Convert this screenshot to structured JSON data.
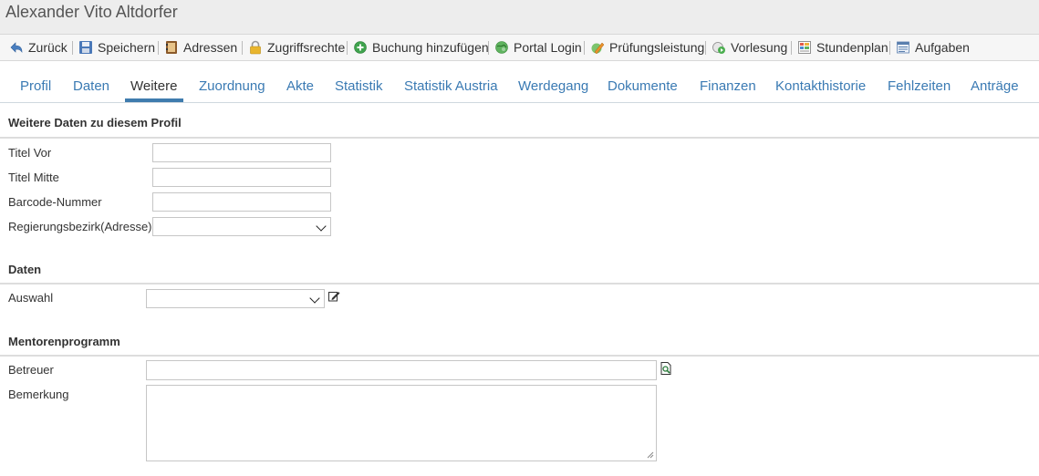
{
  "window": {
    "title": "Alexander Vito Altdorfer"
  },
  "toolbar": {
    "items": [
      {
        "label": "Zurück",
        "icon": "back-arrow-icon"
      },
      {
        "label": "Speichern",
        "icon": "floppy-disk-icon"
      },
      {
        "label": "Adressen",
        "icon": "address-book-icon"
      },
      {
        "label": "Zugriffsrechte",
        "icon": "padlock-icon"
      },
      {
        "label": "Buchung hinzufügen",
        "icon": "add-circle-icon"
      },
      {
        "label": "Portal Login",
        "icon": "globe-icon"
      },
      {
        "label": "Prüfungsleistung",
        "icon": "exam-pencil-icon"
      },
      {
        "label": "Vorlesung",
        "icon": "lecture-play-icon"
      },
      {
        "label": "Stundenplan",
        "icon": "timetable-icon"
      },
      {
        "label": "Aufgaben",
        "icon": "tasks-list-icon"
      }
    ]
  },
  "tabs": [
    {
      "label": "Profil"
    },
    {
      "label": "Daten"
    },
    {
      "label": "Weitere",
      "active": true
    },
    {
      "label": "Zuordnung"
    },
    {
      "label": "Akte"
    },
    {
      "label": "Statistik"
    },
    {
      "label": "Statistik Austria"
    },
    {
      "label": "Werdegang"
    },
    {
      "label": "Dokumente"
    },
    {
      "label": "Finanzen"
    },
    {
      "label": "Kontakthistorie"
    },
    {
      "label": "Fehlzeiten"
    },
    {
      "label": "Anträge"
    }
  ],
  "weitere": {
    "title": "Weitere Daten zu diesem Profil",
    "titel_vor": {
      "label": "Titel Vor",
      "value": ""
    },
    "titel_mitte": {
      "label": "Titel Mitte",
      "value": ""
    },
    "barcode": {
      "label": "Barcode-Nummer",
      "value": ""
    },
    "regierungsbezirk": {
      "label": "Regierungsbezirk(Adresse)",
      "value": ""
    }
  },
  "daten": {
    "title": "Daten",
    "auswahl": {
      "label": "Auswahl",
      "value": ""
    }
  },
  "mentoren": {
    "title": "Mentorenprogramm",
    "betreuer": {
      "label": "Betreuer",
      "value": ""
    },
    "bemerkung": {
      "label": "Bemerkung",
      "value": ""
    }
  },
  "colors": {
    "link": "#3a7ab3",
    "active_underline": "#3f7cae",
    "titlebar_bg": "#ededed"
  }
}
